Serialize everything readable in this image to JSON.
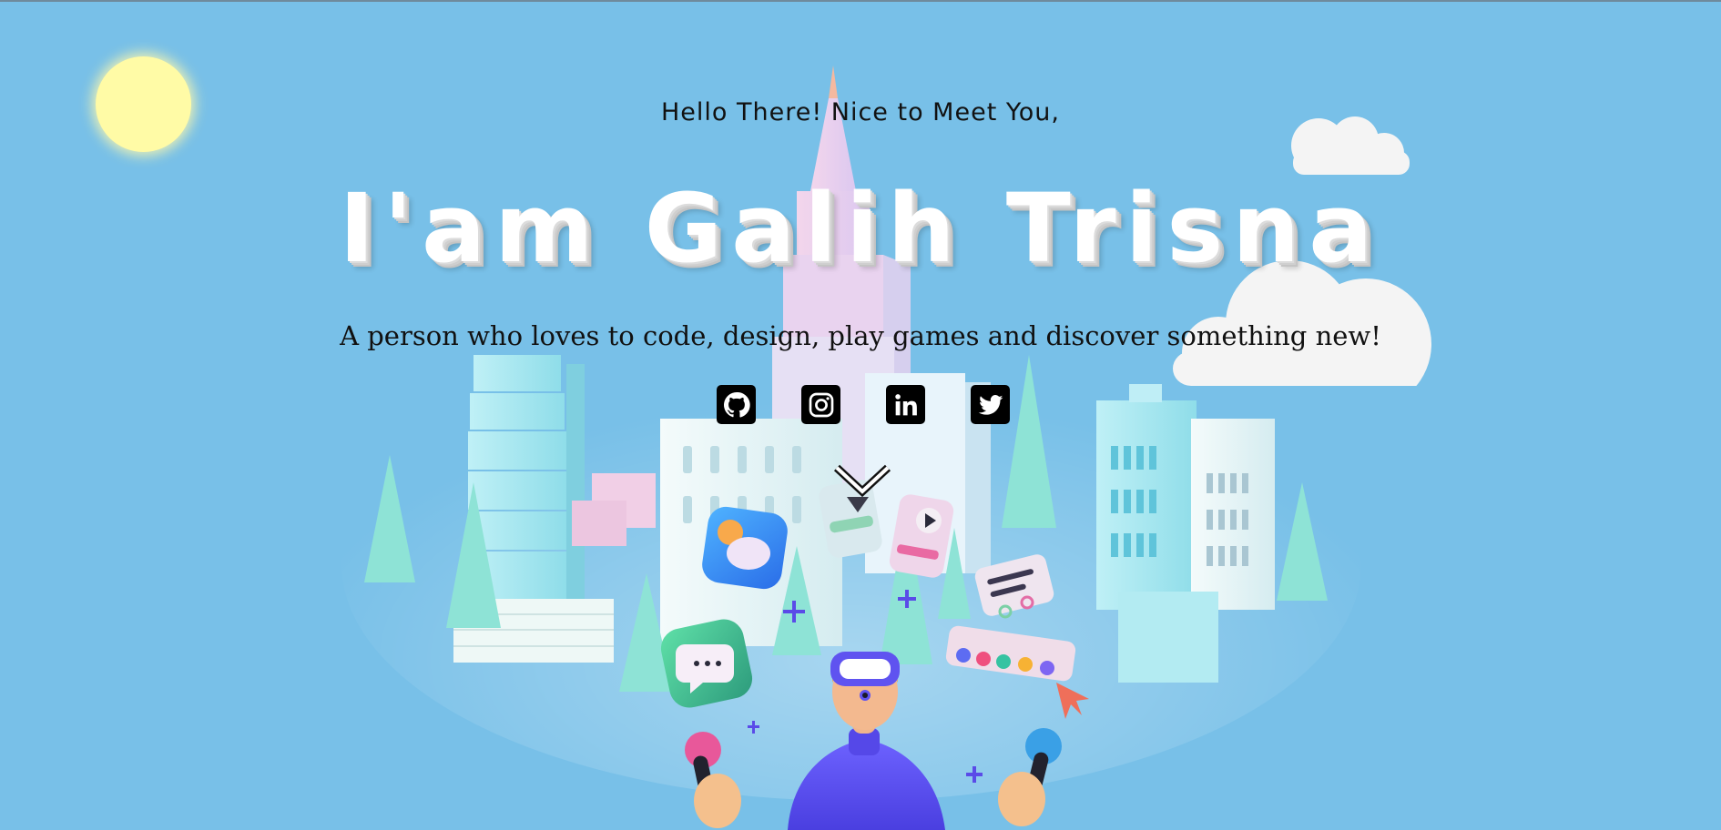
{
  "hero": {
    "greeting": "Hello There! Nice to Meet You,",
    "title": "I'am Galih Trisna",
    "tagline": "A person who loves to code, design, play games and discover something new!"
  },
  "socials": [
    {
      "name": "github",
      "icon": "github-icon"
    },
    {
      "name": "instagram",
      "icon": "instagram-icon"
    },
    {
      "name": "linkedin",
      "icon": "linkedin-icon"
    },
    {
      "name": "twitter",
      "icon": "twitter-icon"
    }
  ],
  "scroll": {
    "icon": "chevron-down-icon"
  },
  "colors": {
    "sky": "#78c0e8",
    "sun": "#fffba6",
    "cloud": "#f4f4f4",
    "title": "#ffffff",
    "text": "#111111",
    "icon_bg": "#000000",
    "character": "#5e52f0"
  }
}
